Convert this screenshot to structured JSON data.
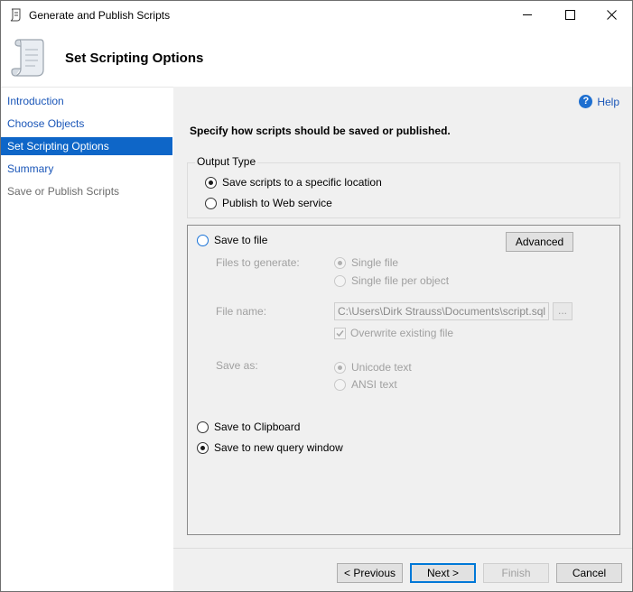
{
  "window": {
    "title": "Generate and Publish Scripts"
  },
  "header": {
    "title": "Set Scripting Options"
  },
  "sidebar": {
    "items": [
      {
        "label": "Introduction",
        "state": "link"
      },
      {
        "label": "Choose Objects",
        "state": "link"
      },
      {
        "label": "Set Scripting Options",
        "state": "active"
      },
      {
        "label": "Summary",
        "state": "link"
      },
      {
        "label": "Save or Publish Scripts",
        "state": "disabled"
      }
    ]
  },
  "main": {
    "help_label": "Help",
    "instruction": "Specify how scripts should be saved or published.",
    "output_type": {
      "label": "Output Type",
      "options": [
        {
          "label": "Save scripts to a specific location",
          "checked": true
        },
        {
          "label": "Publish to Web service",
          "checked": false
        }
      ]
    },
    "save_to_file": {
      "label": "Save to file",
      "advanced_button": "Advanced",
      "files_to_generate_label": "Files to generate:",
      "single_file": "Single file",
      "single_file_per_object": "Single file per object",
      "file_name_label": "File name:",
      "file_name_value": "C:\\Users\\Dirk Strauss\\Documents\\script.sql",
      "browse_button": "...",
      "overwrite_label": "Overwrite existing file",
      "save_as_label": "Save as:",
      "unicode_text": "Unicode text",
      "ansi_text": "ANSI text"
    },
    "save_to_clipboard": "Save to Clipboard",
    "save_to_new_query_window": "Save to new query window"
  },
  "footer": {
    "previous": "< Previous",
    "next": "Next >",
    "finish": "Finish",
    "cancel": "Cancel"
  },
  "colors": {
    "active_item_bg": "#0e66c8",
    "link": "#1a56b8",
    "panel_bg": "#f0f0f0"
  }
}
